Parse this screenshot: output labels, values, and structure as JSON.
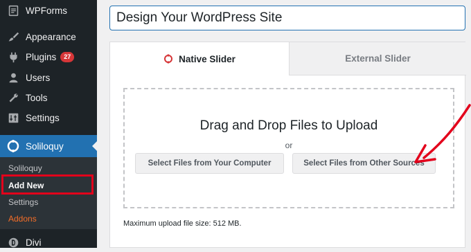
{
  "sidebar": {
    "items": [
      {
        "label": "WPForms",
        "icon": "form-icon"
      },
      {
        "label": "Appearance",
        "icon": "paintbrush-icon"
      },
      {
        "label": "Plugins",
        "icon": "plugin-icon",
        "badge": "27"
      },
      {
        "label": "Users",
        "icon": "user-icon"
      },
      {
        "label": "Tools",
        "icon": "wrench-icon"
      },
      {
        "label": "Settings",
        "icon": "settings-icon"
      }
    ],
    "active": {
      "label": "Soliloquy",
      "icon": "soliloquy-icon"
    },
    "submenu": [
      {
        "label": "Soliloquy"
      },
      {
        "label": "Add New"
      },
      {
        "label": "Settings"
      },
      {
        "label": "Addons"
      }
    ],
    "bottom": {
      "label": "Divi",
      "icon": "divi-icon"
    }
  },
  "editor": {
    "title_value": "Design Your WordPress Site"
  },
  "tabs": {
    "native": "Native Slider",
    "external": "External Slider"
  },
  "upload": {
    "heading": "Drag and Drop Files to Upload",
    "or": "or",
    "button_computer": "Select Files from Your Computer",
    "button_other": "Select Files from Other Sources",
    "max_size": "Maximum upload file size: 512 MB."
  },
  "colors": {
    "sidebar_bg": "#1d2327",
    "active_bg": "#2271b1",
    "highlight": "#e3001b",
    "badge": "#d63638",
    "addons": "#f56e28"
  }
}
